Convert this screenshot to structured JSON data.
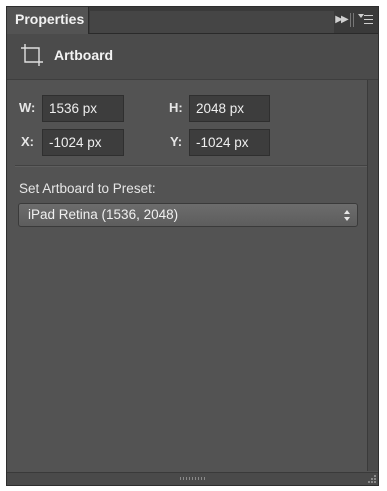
{
  "panel": {
    "tab_label": "Properties"
  },
  "header": {
    "icon": "artboard-icon",
    "title": "Artboard"
  },
  "fields": {
    "w": {
      "label": "W:",
      "value": "1536 px"
    },
    "h": {
      "label": "H:",
      "value": "2048 px"
    },
    "x": {
      "label": "X:",
      "value": "-1024 px"
    },
    "y": {
      "label": "Y:",
      "value": "-1024 px"
    }
  },
  "preset": {
    "label": "Set Artboard to Preset:",
    "selected": "iPad Retina (1536, 2048)"
  },
  "colors": {
    "panel_bg": "#535353",
    "tab_bar_bg": "#3a3a3a",
    "input_bg": "#3d3d3d",
    "text": "#e6e6e6"
  }
}
